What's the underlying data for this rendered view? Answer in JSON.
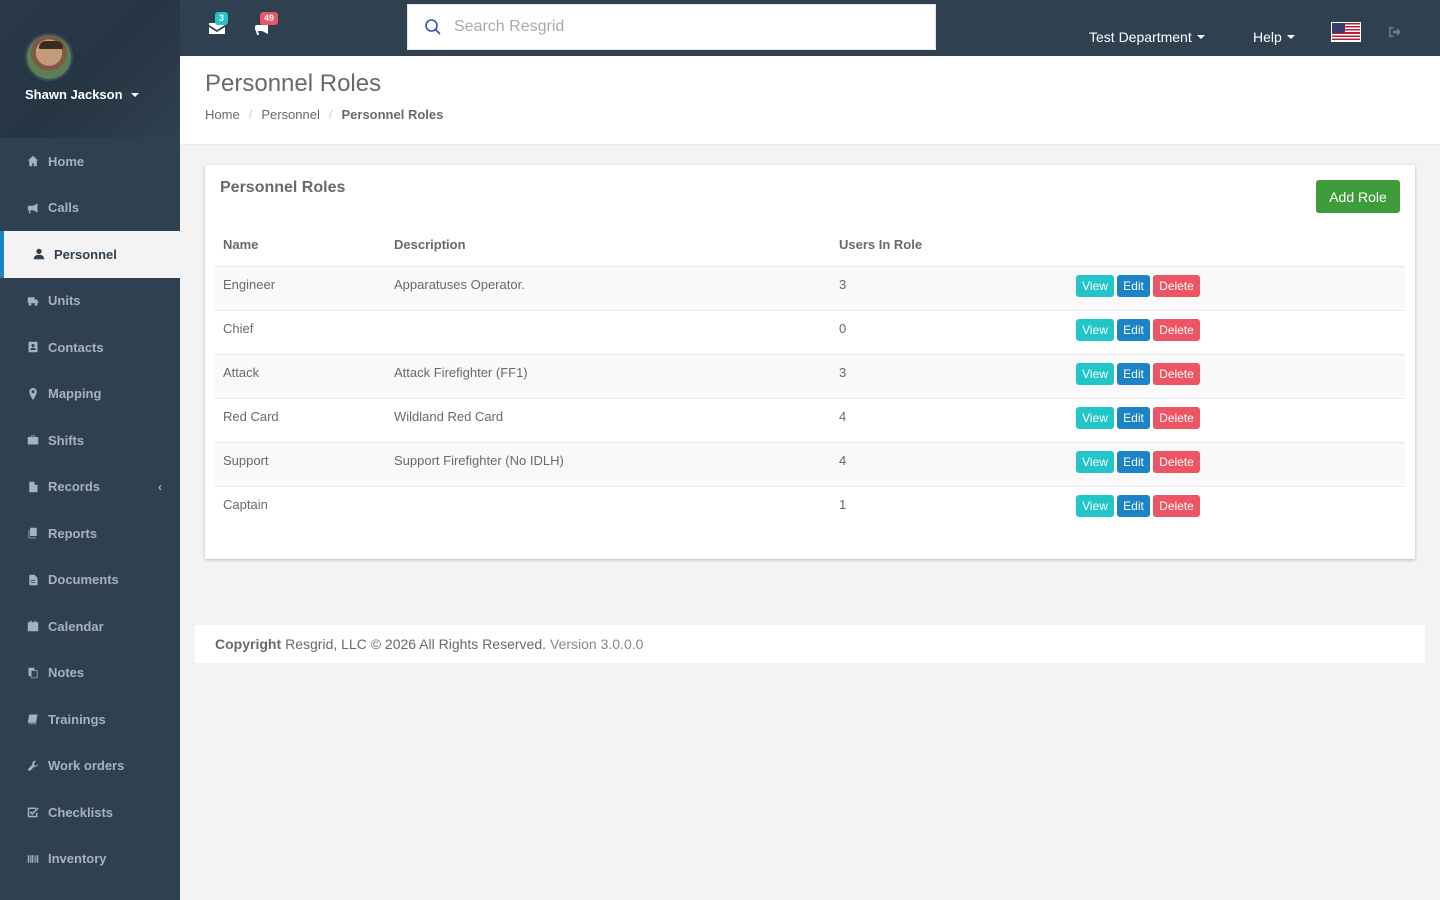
{
  "user": {
    "name": "Shawn Jackson"
  },
  "sidebar": {
    "items": [
      {
        "label": "Home",
        "icon": "home-icon"
      },
      {
        "label": "Calls",
        "icon": "bullhorn-icon"
      },
      {
        "label": "Personnel",
        "icon": "user-icon",
        "active": true
      },
      {
        "label": "Units",
        "icon": "truck-icon"
      },
      {
        "label": "Contacts",
        "icon": "address-book-icon"
      },
      {
        "label": "Mapping",
        "icon": "map-marker-icon"
      },
      {
        "label": "Shifts",
        "icon": "briefcase-icon"
      },
      {
        "label": "Records",
        "icon": "file-icon",
        "arrow": "‹"
      },
      {
        "label": "Reports",
        "icon": "reports-icon"
      },
      {
        "label": "Documents",
        "icon": "document-icon"
      },
      {
        "label": "Calendar",
        "icon": "calendar-icon"
      },
      {
        "label": "Notes",
        "icon": "notes-icon"
      },
      {
        "label": "Trainings",
        "icon": "book-icon"
      },
      {
        "label": "Work orders",
        "icon": "wrench-icon"
      },
      {
        "label": "Checklists",
        "icon": "check-square-icon"
      },
      {
        "label": "Inventory",
        "icon": "barcode-icon"
      }
    ]
  },
  "topbar": {
    "messages_count": "3",
    "calls_count": "49",
    "search_placeholder": "Search Resgrid",
    "department": "Test Department",
    "help": "Help"
  },
  "page": {
    "title": "Personnel Roles",
    "breadcrumb": [
      "Home",
      "Personnel",
      "Personnel Roles"
    ]
  },
  "panel": {
    "title": "Personnel Roles",
    "add_button": "Add Role",
    "columns": [
      "Name",
      "Description",
      "Users In Role"
    ],
    "rows": [
      {
        "name": "Engineer",
        "description": "Apparatuses Operator.",
        "users": "3"
      },
      {
        "name": "Chief",
        "description": "",
        "users": "0"
      },
      {
        "name": "Attack",
        "description": "Attack Firefighter (FF1)",
        "users": "3"
      },
      {
        "name": "Red Card",
        "description": "Wildland Red Card",
        "users": "4"
      },
      {
        "name": "Support",
        "description": "Support Firefighter (No IDLH)",
        "users": "4"
      },
      {
        "name": "Captain",
        "description": "",
        "users": "1"
      }
    ],
    "actions": {
      "view": "View",
      "edit": "Edit",
      "delete": "Delete"
    }
  },
  "footer": {
    "copyright_label": "Copyright",
    "copyright_text": "Resgrid, LLC © 2026 All Rights Reserved.",
    "version": "Version 3.0.0.0"
  },
  "colors": {
    "sidebar_bg": "#2f4050",
    "accent_green": "#3e9c3a",
    "view_btn": "#23c6c8",
    "edit_btn": "#1c84c6",
    "delete_btn": "#ed5565"
  }
}
